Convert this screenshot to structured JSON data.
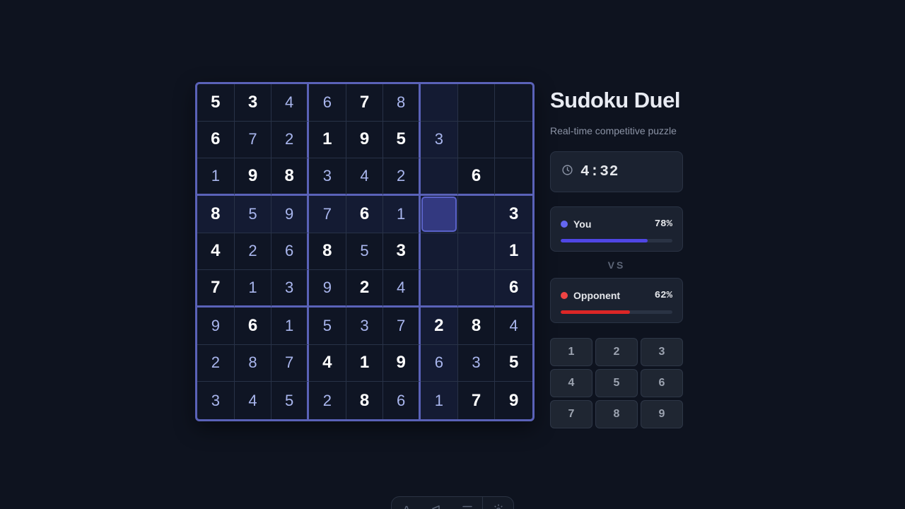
{
  "board": {
    "rows": [
      [
        {
          "v": "5",
          "t": "given"
        },
        {
          "v": "3",
          "t": "given"
        },
        {
          "v": "4",
          "t": "entered"
        },
        {
          "v": "6",
          "t": "entered"
        },
        {
          "v": "7",
          "t": "given"
        },
        {
          "v": "8",
          "t": "entered"
        },
        {
          "v": "",
          "t": "empty"
        },
        {
          "v": "",
          "t": "empty"
        },
        {
          "v": "",
          "t": "empty"
        }
      ],
      [
        {
          "v": "6",
          "t": "given"
        },
        {
          "v": "7",
          "t": "entered"
        },
        {
          "v": "2",
          "t": "entered"
        },
        {
          "v": "1",
          "t": "given"
        },
        {
          "v": "9",
          "t": "given"
        },
        {
          "v": "5",
          "t": "given"
        },
        {
          "v": "3",
          "t": "entered"
        },
        {
          "v": "",
          "t": "empty"
        },
        {
          "v": "",
          "t": "empty"
        }
      ],
      [
        {
          "v": "1",
          "t": "entered"
        },
        {
          "v": "9",
          "t": "given"
        },
        {
          "v": "8",
          "t": "given"
        },
        {
          "v": "3",
          "t": "entered"
        },
        {
          "v": "4",
          "t": "entered"
        },
        {
          "v": "2",
          "t": "entered"
        },
        {
          "v": "",
          "t": "empty"
        },
        {
          "v": "6",
          "t": "given"
        },
        {
          "v": "",
          "t": "empty"
        }
      ],
      [
        {
          "v": "8",
          "t": "given"
        },
        {
          "v": "5",
          "t": "entered"
        },
        {
          "v": "9",
          "t": "entered"
        },
        {
          "v": "7",
          "t": "entered"
        },
        {
          "v": "6",
          "t": "given"
        },
        {
          "v": "1",
          "t": "entered"
        },
        {
          "v": "",
          "t": "empty"
        },
        {
          "v": "",
          "t": "empty"
        },
        {
          "v": "3",
          "t": "given"
        }
      ],
      [
        {
          "v": "4",
          "t": "given"
        },
        {
          "v": "2",
          "t": "entered"
        },
        {
          "v": "6",
          "t": "entered"
        },
        {
          "v": "8",
          "t": "given"
        },
        {
          "v": "5",
          "t": "entered"
        },
        {
          "v": "3",
          "t": "given"
        },
        {
          "v": "",
          "t": "empty"
        },
        {
          "v": "",
          "t": "empty"
        },
        {
          "v": "1",
          "t": "given"
        }
      ],
      [
        {
          "v": "7",
          "t": "given"
        },
        {
          "v": "1",
          "t": "entered"
        },
        {
          "v": "3",
          "t": "entered"
        },
        {
          "v": "9",
          "t": "entered"
        },
        {
          "v": "2",
          "t": "given"
        },
        {
          "v": "4",
          "t": "entered"
        },
        {
          "v": "",
          "t": "empty"
        },
        {
          "v": "",
          "t": "empty"
        },
        {
          "v": "6",
          "t": "given"
        }
      ],
      [
        {
          "v": "9",
          "t": "entered"
        },
        {
          "v": "6",
          "t": "given"
        },
        {
          "v": "1",
          "t": "entered"
        },
        {
          "v": "5",
          "t": "entered"
        },
        {
          "v": "3",
          "t": "entered"
        },
        {
          "v": "7",
          "t": "entered"
        },
        {
          "v": "2",
          "t": "given"
        },
        {
          "v": "8",
          "t": "given"
        },
        {
          "v": "4",
          "t": "entered"
        }
      ],
      [
        {
          "v": "2",
          "t": "entered"
        },
        {
          "v": "8",
          "t": "entered"
        },
        {
          "v": "7",
          "t": "entered"
        },
        {
          "v": "4",
          "t": "given"
        },
        {
          "v": "1",
          "t": "given"
        },
        {
          "v": "9",
          "t": "given"
        },
        {
          "v": "6",
          "t": "entered"
        },
        {
          "v": "3",
          "t": "entered"
        },
        {
          "v": "5",
          "t": "given"
        }
      ],
      [
        {
          "v": "3",
          "t": "entered"
        },
        {
          "v": "4",
          "t": "entered"
        },
        {
          "v": "5",
          "t": "entered"
        },
        {
          "v": "2",
          "t": "entered"
        },
        {
          "v": "8",
          "t": "given"
        },
        {
          "v": "6",
          "t": "entered"
        },
        {
          "v": "1",
          "t": "entered"
        },
        {
          "v": "7",
          "t": "given"
        },
        {
          "v": "9",
          "t": "given"
        }
      ]
    ],
    "selected": {
      "row": 4,
      "col": 7
    }
  },
  "panel": {
    "title": "Sudoku Duel",
    "subtitle": "Real-time competitive puzzle",
    "timer": {
      "icon": "clock-icon",
      "value": "4:32"
    },
    "you": {
      "name": "You",
      "percent": "78%",
      "progress": 0.78,
      "color": "#6366f1",
      "bar_color": "#4f46e5"
    },
    "vs": "VS",
    "opponent": {
      "name": "Opponent",
      "percent": "62%",
      "progress": 0.62,
      "color": "#ef4444",
      "bar_color": "#dc2626"
    },
    "numpad": [
      "1",
      "2",
      "3",
      "4",
      "5",
      "6",
      "7",
      "8",
      "9"
    ]
  },
  "toolbar": {
    "icons": [
      "pen-icon",
      "megaphone-icon",
      "menu-icon",
      "gear-icon"
    ]
  },
  "colors": {
    "background": "#0e131f",
    "board_border": "#5a62b8",
    "selected_cell": "#333980"
  }
}
